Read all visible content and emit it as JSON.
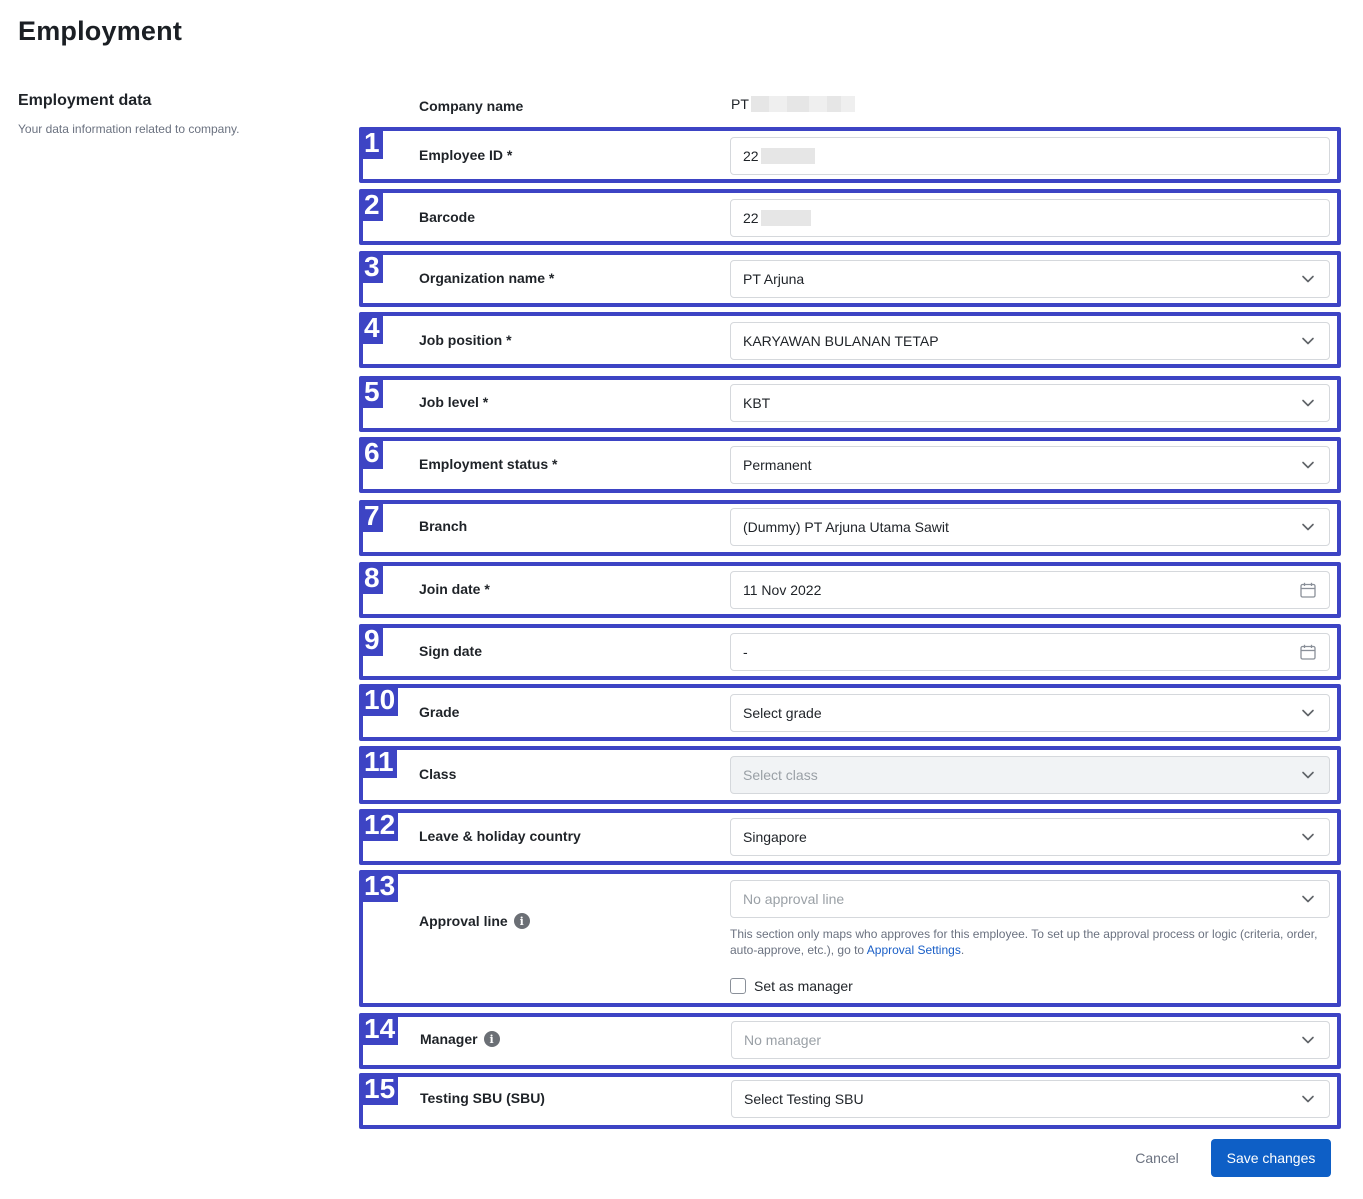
{
  "page_title": "Employment",
  "section": {
    "title": "Employment data",
    "subtitle": "Your data information related to company."
  },
  "company": {
    "label": "Company name",
    "value": "PT"
  },
  "fields": [
    {
      "number": "1",
      "label": "Employee ID *",
      "value": "22",
      "kind": "text",
      "redacted": true
    },
    {
      "number": "2",
      "label": "Barcode",
      "value": "22",
      "kind": "text",
      "redacted": true
    },
    {
      "number": "3",
      "label": "Organization name *",
      "value": "PT Arjuna",
      "kind": "select"
    },
    {
      "number": "4",
      "label": "Job position *",
      "value": "KARYAWAN BULANAN TETAP",
      "kind": "select"
    },
    {
      "number": "5",
      "label": "Job level *",
      "value": "KBT",
      "kind": "select"
    },
    {
      "number": "6",
      "label": "Employment status *",
      "value": "Permanent",
      "kind": "select"
    },
    {
      "number": "7",
      "label": "Branch",
      "value": "(Dummy) PT Arjuna Utama Sawit",
      "kind": "select"
    },
    {
      "number": "8",
      "label": "Join date *",
      "value": "11 Nov 2022",
      "kind": "date"
    },
    {
      "number": "9",
      "label": "Sign date",
      "value": "-",
      "kind": "date"
    },
    {
      "number": "10",
      "label": "Grade",
      "value": "Select grade",
      "kind": "select"
    },
    {
      "number": "11",
      "label": "Class",
      "placeholder": "Select class",
      "kind": "select",
      "disabled": true
    },
    {
      "number": "12",
      "label": "Leave & holiday country",
      "value": "Singapore",
      "kind": "select"
    },
    {
      "number": "13",
      "label": "Approval line",
      "placeholder": "No approval line",
      "kind": "select",
      "info": true
    },
    {
      "number": "14",
      "label": "Manager",
      "placeholder": "No manager",
      "kind": "select",
      "info": true
    },
    {
      "number": "15",
      "label": "Testing SBU (SBU)",
      "value": "Select Testing SBU",
      "kind": "select"
    }
  ],
  "approval_help": {
    "text": "This section only maps who approves for this employee. To set up the approval process or logic (criteria, order, auto-approve, etc.), go to ",
    "link": "Approval Settings",
    "suffix": "."
  },
  "set_as_manager": {
    "label": "Set as manager",
    "checked": false
  },
  "actions": {
    "cancel": "Cancel",
    "save": "Save changes"
  },
  "colors": {
    "highlight": "#3d44c4",
    "primary_button": "#0e5fc6",
    "link": "#1a5fc7"
  },
  "icons": {
    "select": "chevron-down-icon",
    "date": "calendar-icon",
    "info": "info-icon"
  }
}
